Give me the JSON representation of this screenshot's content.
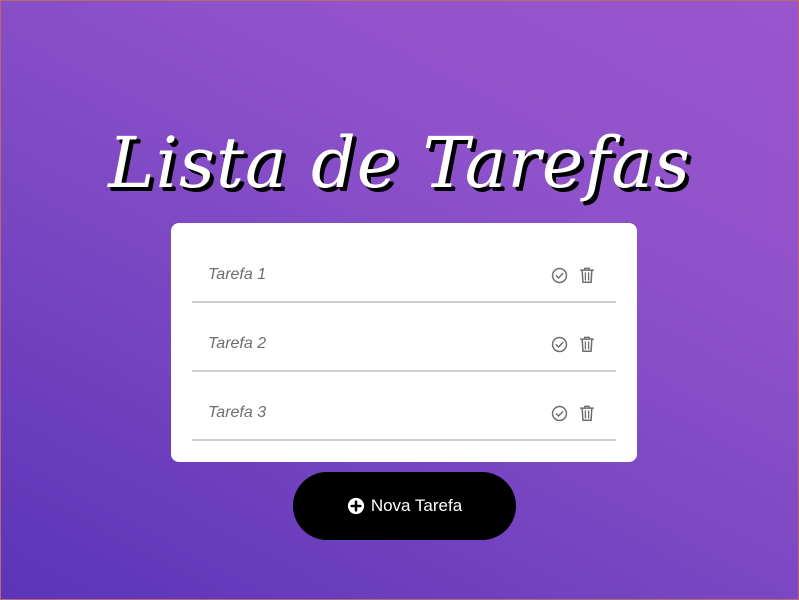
{
  "app": {
    "title": "Lista de Tarefas"
  },
  "tasks": [
    {
      "label": "Tarefa 1"
    },
    {
      "label": "Tarefa 2"
    },
    {
      "label": "Tarefa 3"
    }
  ],
  "icons": {
    "complete": "check-circle-icon",
    "delete": "trash-icon",
    "add": "plus-circle-icon"
  },
  "actions": {
    "new_task_label": "Nova Tarefa"
  },
  "colors": {
    "background_start": "#5b34b8",
    "background_end": "#9b55cc",
    "card": "#ffffff",
    "button": "#000000",
    "button_text": "#ffffff",
    "task_text": "#6e6e6e",
    "divider": "#cfcfcf"
  }
}
